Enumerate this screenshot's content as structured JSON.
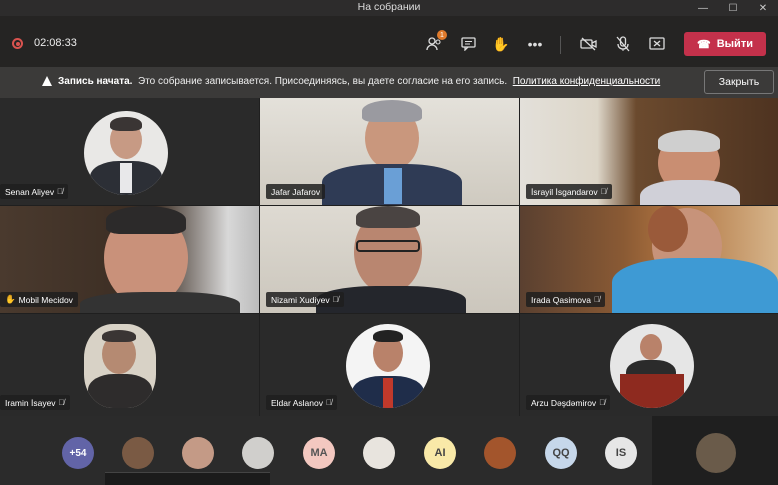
{
  "window": {
    "title": "На собрании"
  },
  "toolbar": {
    "timer": "02:08:33",
    "participants_badge": "1",
    "leave_label": "Выйти"
  },
  "banner": {
    "bold": "Запись начата.",
    "text": "Это собрание записывается. Присоединяясь, вы даете согласие на его запись.",
    "link": "Политика конфиденциальности",
    "close_label": "Закрыть"
  },
  "participants": [
    {
      "name": "Senan Aliyev"
    },
    {
      "name": "Jafar Jafarov"
    },
    {
      "name": "İsrayil İsgandarov"
    },
    {
      "name": "Mobil Mecidov"
    },
    {
      "name": "Nizami Xudiyev"
    },
    {
      "name": "Irada Qasimova"
    },
    {
      "name": "Iramin İsayev"
    },
    {
      "name": "Eldar Aslanov"
    },
    {
      "name": "Arzu Dəşdəmirov"
    }
  ],
  "roster": {
    "more": "+54",
    "initials": [
      "MA",
      "AI",
      "QQ",
      "IS"
    ]
  },
  "colors": {
    "leave": "#c4314b",
    "more_chip": "#6264a7"
  }
}
